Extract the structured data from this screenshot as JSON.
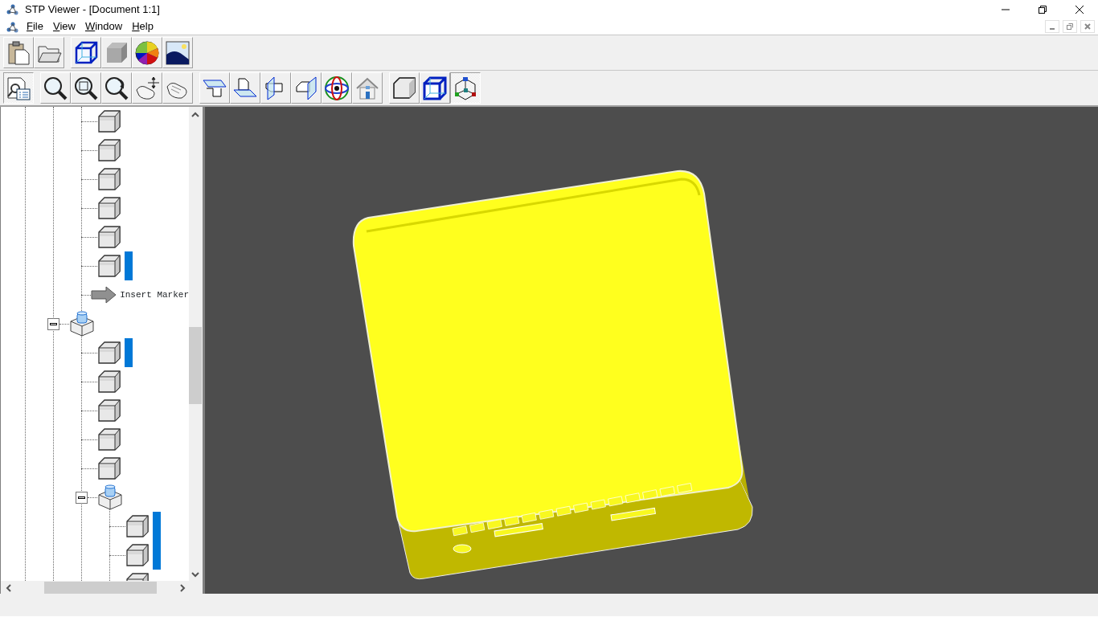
{
  "window": {
    "title": "STP Viewer - [Document 1:1]"
  },
  "menu": [
    "File",
    "View",
    "Window",
    "Help"
  ],
  "toolbar_top": [
    {
      "pressed": false
    },
    {
      "pressed": false
    },
    {
      "pressed": false
    },
    {
      "pressed": false
    },
    {
      "pressed": false
    },
    {
      "pressed": false
    }
  ],
  "toolbar_view": [
    {
      "pressed": true
    },
    {
      "pressed": false
    },
    {
      "pressed": false
    },
    {
      "pressed": false
    },
    {
      "pressed": false
    },
    {
      "pressed": false
    },
    {
      "pressed": false
    },
    {
      "pressed": false
    },
    {
      "pressed": false
    },
    {
      "pressed": false
    },
    {
      "pressed": false
    },
    {
      "pressed": false
    },
    {
      "pressed": false
    },
    {
      "pressed": false
    },
    {
      "pressed": true
    }
  ],
  "tree": {
    "continued_items": [
      {
        "kind": "part",
        "selected": false
      },
      {
        "kind": "part",
        "selected": false
      },
      {
        "kind": "part",
        "selected": false
      },
      {
        "kind": "part",
        "selected": false
      },
      {
        "kind": "part",
        "selected": false
      },
      {
        "kind": "part",
        "selected": true
      },
      {
        "kind": "marker",
        "label": "Insert Marker"
      }
    ],
    "items": [
      {
        "kind": "assembly",
        "expanded": true,
        "children": [
          {
            "kind": "part",
            "selected": true
          },
          {
            "kind": "part",
            "selected": false
          },
          {
            "kind": "part",
            "selected": false
          },
          {
            "kind": "part",
            "selected": false
          },
          {
            "kind": "part",
            "selected": false
          },
          {
            "kind": "assembly",
            "expanded": true,
            "children": [
              {
                "kind": "part",
                "selected": true
              },
              {
                "kind": "part",
                "selected": true
              },
              {
                "kind": "part",
                "selected": false
              }
            ]
          }
        ]
      }
    ]
  }
}
